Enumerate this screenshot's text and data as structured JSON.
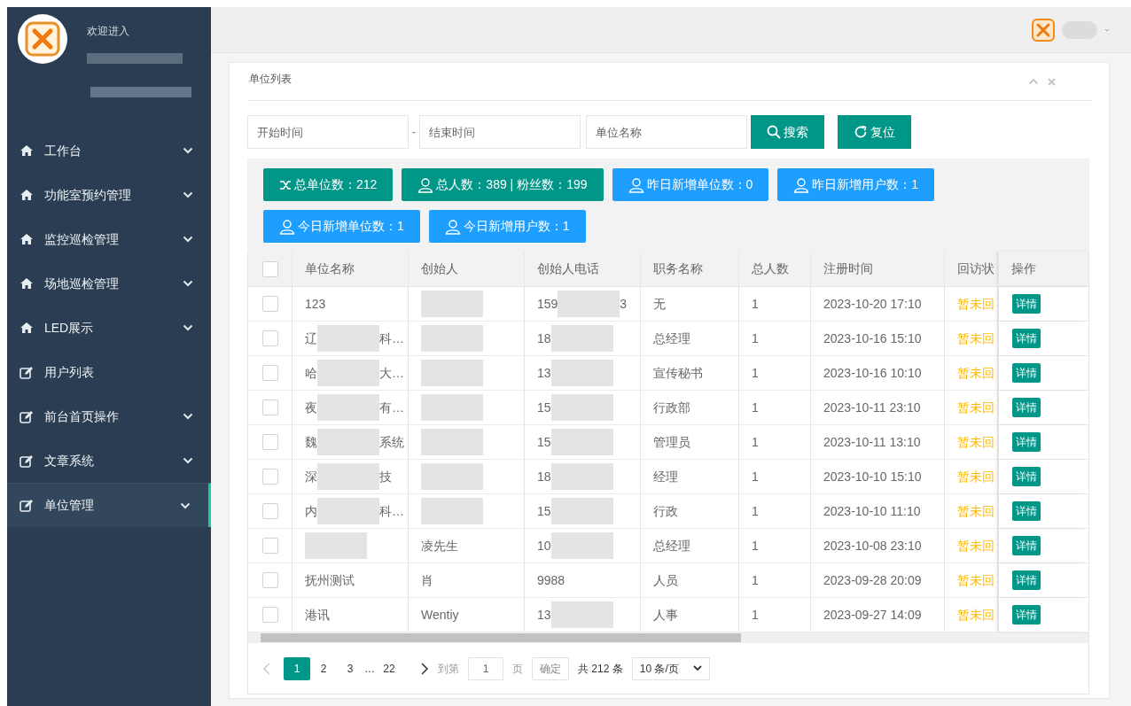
{
  "sidebar": {
    "welcome": "欢迎进入",
    "items": [
      {
        "kind": "home",
        "label": "工作台",
        "expandable": true,
        "selected": false
      },
      {
        "kind": "home",
        "label": "功能室预约管理",
        "expandable": true,
        "selected": false
      },
      {
        "kind": "home",
        "label": "监控巡检管理",
        "expandable": true,
        "selected": false
      },
      {
        "kind": "home",
        "label": "场地巡检管理",
        "expandable": true,
        "selected": false
      },
      {
        "kind": "home",
        "label": "LED展示",
        "expandable": true,
        "selected": false
      },
      {
        "kind": "edit",
        "label": "用户列表",
        "expandable": false,
        "selected": false
      },
      {
        "kind": "edit",
        "label": "前台首页操作",
        "expandable": true,
        "selected": false
      },
      {
        "kind": "edit",
        "label": "文章系统",
        "expandable": true,
        "selected": false
      },
      {
        "kind": "edit",
        "label": "单位管理",
        "expandable": true,
        "selected": true
      }
    ]
  },
  "panel": {
    "title": "单位列表",
    "filters": [
      {
        "placeholder": "开始时间"
      },
      {
        "separator": "-",
        "placeholder": "结束时间"
      },
      {
        "placeholder": "单位名称"
      }
    ],
    "buttons": [
      {
        "kind": "search",
        "label": "搜索"
      },
      {
        "kind": "refresh",
        "label": "复位"
      }
    ],
    "stats": [
      {
        "kind": "shuffle",
        "label": "总单位数：212",
        "color": "#009688"
      },
      {
        "kind": "user",
        "label": "总人数：389 | 粉丝数：199",
        "color": "#009688"
      },
      {
        "kind": "user",
        "label": "昨日新增单位数：0",
        "color": "#1e9fff"
      },
      {
        "kind": "user",
        "label": "昨日新增用户数：1",
        "color": "#1e9fff"
      },
      {
        "kind": "user",
        "label": "今日新增单位数：1",
        "color": "#1e9fff"
      },
      {
        "kind": "user",
        "label": "今日新增用户数：1",
        "color": "#1e9fff"
      }
    ],
    "table": {
      "select_all_checked": false,
      "columns": [
        "单位名称",
        "创始人",
        "创始人电话",
        "职务名称",
        "总人数",
        "注册时间",
        "回访状",
        "操作"
      ],
      "rows": [
        {
          "checked": false,
          "name": {
            "prefix": "123",
            "redacted": false
          },
          "creator": {
            "redacted": true
          },
          "phone": {
            "prefix": "159",
            "suffix": "3",
            "redacted": true
          },
          "title": "无",
          "count": "1",
          "time": "2023-10-20 17:10",
          "status": "暂未回",
          "action": "详情"
        },
        {
          "checked": false,
          "name": {
            "prefix": "辽",
            "suffix": "科…",
            "redacted": true
          },
          "creator": {
            "redacted": true
          },
          "phone": {
            "prefix": "18",
            "redacted": true
          },
          "title": "总经理",
          "count": "1",
          "time": "2023-10-16 15:10",
          "status": "暂未回",
          "action": "详情"
        },
        {
          "checked": false,
          "name": {
            "prefix": "哈",
            "suffix": "大…",
            "redacted": true
          },
          "creator": {
            "redacted": true
          },
          "phone": {
            "prefix": "13",
            "redacted": true
          },
          "title": "宣传秘书",
          "count": "1",
          "time": "2023-10-16 10:10",
          "status": "暂未回",
          "action": "详情"
        },
        {
          "checked": false,
          "name": {
            "prefix": "夜",
            "suffix": "有…",
            "redacted": true
          },
          "creator": {
            "redacted": true
          },
          "phone": {
            "prefix": "15",
            "redacted": true
          },
          "title": "行政部",
          "count": "1",
          "time": "2023-10-11 23:10",
          "status": "暂未回",
          "action": "详情"
        },
        {
          "checked": false,
          "name": {
            "prefix": "魏",
            "suffix": "系统",
            "redacted": true
          },
          "creator": {
            "redacted": true
          },
          "phone": {
            "prefix": "15",
            "redacted": true
          },
          "title": "管理员",
          "count": "1",
          "time": "2023-10-11 13:10",
          "status": "暂未回",
          "action": "详情"
        },
        {
          "checked": false,
          "name": {
            "prefix": "深",
            "suffix": "技",
            "redacted": true
          },
          "creator": {
            "redacted": true
          },
          "phone": {
            "prefix": "18",
            "redacted": true
          },
          "title": "经理",
          "count": "1",
          "time": "2023-10-10 15:10",
          "status": "暂未回",
          "action": "详情"
        },
        {
          "checked": false,
          "name": {
            "prefix": "内",
            "suffix": "科…",
            "redacted": true
          },
          "creator": {
            "redacted": true
          },
          "phone": {
            "prefix": "15",
            "redacted": true
          },
          "title": "行政",
          "count": "1",
          "time": "2023-10-10 11:10",
          "status": "暂未回",
          "action": "详情"
        },
        {
          "checked": false,
          "name": {
            "redacted": true
          },
          "creator": {
            "prefix": "凌先生",
            "redacted": false
          },
          "phone": {
            "prefix": "10",
            "redacted": true
          },
          "title": "总经理",
          "count": "1",
          "time": "2023-10-08 23:10",
          "status": "暂未回",
          "action": "详情"
        },
        {
          "checked": false,
          "name": {
            "prefix": "抚州测试",
            "redacted": false
          },
          "creator": {
            "prefix": "肖",
            "redacted": false
          },
          "phone": {
            "prefix": "9988",
            "redacted": false
          },
          "title": "人员",
          "count": "1",
          "time": "2023-09-28 20:09",
          "status": "暂未回",
          "action": "详情"
        },
        {
          "checked": false,
          "name": {
            "prefix": "港讯",
            "redacted": false
          },
          "creator": {
            "prefix": "Wentiy",
            "redacted": false
          },
          "phone": {
            "prefix": "13",
            "redacted": true
          },
          "title": "人事",
          "count": "1",
          "time": "2023-09-27 14:09",
          "status": "暂未回",
          "action": "详情"
        }
      ]
    },
    "pagination": {
      "pages": [
        {
          "kind": "page",
          "label": "1",
          "selected": true
        },
        {
          "kind": "page",
          "label": "2",
          "selected": false
        },
        {
          "kind": "page",
          "label": "3",
          "selected": false
        },
        {
          "kind": "ellipsis",
          "label": "…"
        },
        {
          "kind": "page",
          "label": "22",
          "selected": false
        }
      ],
      "goto_label": "到第",
      "goto_value": "1",
      "page_unit": "页",
      "confirm": "确定",
      "total": "共 212 条",
      "page_size": "10 条/页"
    }
  }
}
